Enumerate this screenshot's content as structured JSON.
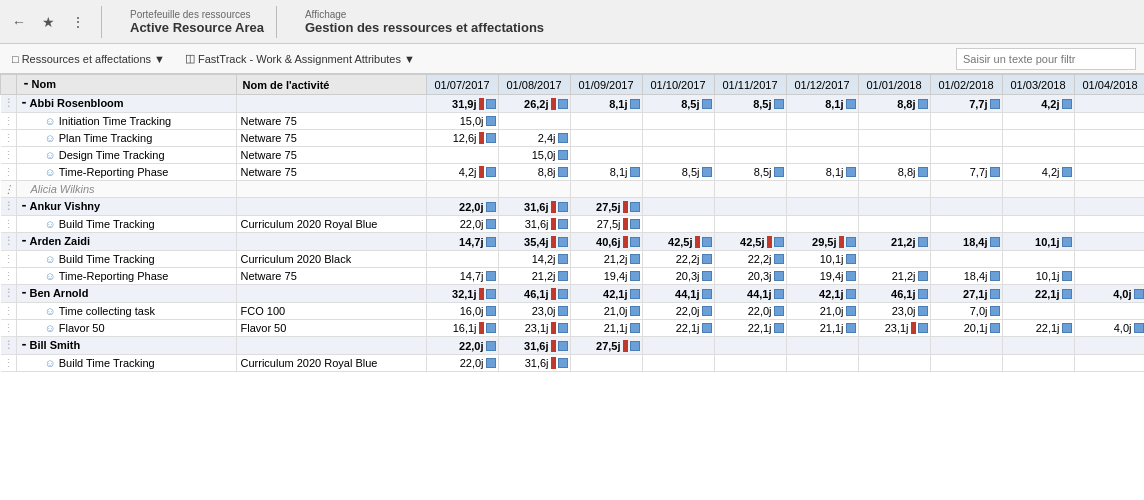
{
  "topbar": {
    "portfolio_label": "Portefeuille des ressources",
    "portfolio_title": "Active Resource Area",
    "affichage_label": "Affichage",
    "affichage_title": "Gestion des ressources et affectations"
  },
  "toolbar": {
    "resources_btn": "Ressources et affectations",
    "fasttrack_btn": "FastTrack - Work & Assignment Attributes",
    "search_placeholder": "Saisir un texte pour filtr"
  },
  "columns": {
    "name": "Nom",
    "activity": "Nom de l'activité",
    "dates": [
      "01/07/2017",
      "01/08/2017",
      "01/09/2017",
      "01/10/2017",
      "01/11/2017",
      "01/12/2017",
      "01/01/2018",
      "01/02/2018",
      "01/03/2018",
      "01/04/2018"
    ]
  },
  "rows": [
    {
      "type": "group",
      "name": "Abbi Rosenbloom",
      "activity": "",
      "vals": [
        "31,9j",
        "26,2j",
        "8,1j",
        "8,5j",
        "8,5j",
        "8,1j",
        "8,8j",
        "7,7j",
        "4,2j",
        ""
      ],
      "hasRed": [
        true,
        true,
        false,
        false,
        false,
        false,
        false,
        false,
        false,
        false
      ]
    },
    {
      "type": "sub",
      "name": "Initiation Time Tracking",
      "activity": "Netware 75",
      "vals": [
        "15,0j",
        "",
        "",
        "",
        "",
        "",
        "",
        "",
        "",
        ""
      ],
      "hasRed": [
        false,
        false,
        false,
        false,
        false,
        false,
        false,
        false,
        false,
        false
      ]
    },
    {
      "type": "sub",
      "name": "Plan Time Tracking",
      "activity": "Netware 75",
      "vals": [
        "12,6j",
        "2,4j",
        "",
        "",
        "",
        "",
        "",
        "",
        "",
        ""
      ],
      "hasRed": [
        true,
        false,
        false,
        false,
        false,
        false,
        false,
        false,
        false,
        false
      ]
    },
    {
      "type": "sub",
      "name": "Design Time Tracking",
      "activity": "Netware 75",
      "vals": [
        "",
        "15,0j",
        "",
        "",
        "",
        "",
        "",
        "",
        "",
        ""
      ],
      "hasRed": [
        false,
        false,
        false,
        false,
        false,
        false,
        false,
        false,
        false,
        false
      ]
    },
    {
      "type": "sub",
      "name": "Time-Reporting Phase",
      "activity": "Netware 75",
      "vals": [
        "4,2j",
        "8,8j",
        "8,1j",
        "8,5j",
        "8,5j",
        "8,1j",
        "8,8j",
        "7,7j",
        "4,2j",
        ""
      ],
      "hasRed": [
        true,
        false,
        false,
        false,
        false,
        false,
        false,
        false,
        false,
        false
      ]
    },
    {
      "type": "person",
      "name": "Alicia Wilkins",
      "activity": "",
      "vals": [
        "",
        "",
        "",
        "",
        "",
        "",
        "",
        "",
        "",
        ""
      ]
    },
    {
      "type": "group",
      "name": "Ankur Vishny",
      "activity": "",
      "vals": [
        "22,0j",
        "31,6j",
        "27,5j",
        "",
        "",
        "",
        "",
        "",
        "",
        ""
      ],
      "hasRed": [
        false,
        true,
        true,
        false,
        false,
        false,
        false,
        false,
        false,
        false
      ]
    },
    {
      "type": "sub",
      "name": "Build Time Tracking",
      "activity": "Curriculum 2020 Royal Blue",
      "vals": [
        "22,0j",
        "31,6j",
        "27,5j",
        "",
        "",
        "",
        "",
        "",
        "",
        ""
      ],
      "hasRed": [
        false,
        true,
        true,
        false,
        false,
        false,
        false,
        false,
        false,
        false
      ]
    },
    {
      "type": "group",
      "name": "Arden Zaidi",
      "activity": "",
      "vals": [
        "14,7j",
        "35,4j",
        "40,6j",
        "42,5j",
        "42,5j",
        "29,5j",
        "21,2j",
        "18,4j",
        "10,1j",
        ""
      ],
      "hasRed": [
        false,
        true,
        true,
        true,
        true,
        true,
        false,
        false,
        false,
        false
      ]
    },
    {
      "type": "sub",
      "name": "Build Time Tracking",
      "activity": "Curriculum 2020 Black",
      "vals": [
        "",
        "14,2j",
        "21,2j",
        "22,2j",
        "22,2j",
        "10,1j",
        "",
        "",
        "",
        ""
      ],
      "hasRed": [
        false,
        false,
        false,
        false,
        false,
        false,
        false,
        false,
        false,
        false
      ]
    },
    {
      "type": "sub",
      "name": "Time-Reporting Phase",
      "activity": "Netware 75",
      "vals": [
        "14,7j",
        "21,2j",
        "19,4j",
        "20,3j",
        "20,3j",
        "19,4j",
        "21,2j",
        "18,4j",
        "10,1j",
        ""
      ],
      "hasRed": [
        false,
        false,
        false,
        false,
        false,
        false,
        false,
        false,
        false,
        false
      ]
    },
    {
      "type": "group",
      "name": "Ben Arnold",
      "activity": "",
      "vals": [
        "32,1j",
        "46,1j",
        "42,1j",
        "44,1j",
        "44,1j",
        "42,1j",
        "46,1j",
        "27,1j",
        "22,1j",
        "4,0j"
      ],
      "hasRed": [
        true,
        true,
        false,
        false,
        false,
        false,
        false,
        false,
        false,
        false
      ]
    },
    {
      "type": "sub",
      "name": "Time collecting task",
      "activity": "FCO 100",
      "vals": [
        "16,0j",
        "23,0j",
        "21,0j",
        "22,0j",
        "22,0j",
        "21,0j",
        "23,0j",
        "7,0j",
        "",
        ""
      ],
      "hasRed": [
        false,
        false,
        false,
        false,
        false,
        false,
        false,
        false,
        false,
        false
      ]
    },
    {
      "type": "sub",
      "name": "Flavor 50",
      "activity": "Flavor 50",
      "vals": [
        "16,1j",
        "23,1j",
        "21,1j",
        "22,1j",
        "22,1j",
        "21,1j",
        "23,1j",
        "20,1j",
        "22,1j",
        "4,0j"
      ],
      "hasRed": [
        true,
        true,
        false,
        false,
        false,
        false,
        true,
        false,
        false,
        false
      ]
    },
    {
      "type": "group",
      "name": "Bill Smith",
      "activity": "",
      "vals": [
        "22,0j",
        "31,6j",
        "27,5j",
        "",
        "",
        "",
        "",
        "",
        "",
        ""
      ],
      "hasRed": [
        false,
        true,
        true,
        false,
        false,
        false,
        false,
        false,
        false,
        false
      ]
    },
    {
      "type": "sub",
      "name": "Build Time Tracking",
      "activity": "Curriculum 2020 Royal Blue",
      "vals": [
        "22,0j",
        "31,6j",
        "",
        "",
        "",
        "",
        "",
        "",
        "",
        ""
      ],
      "hasRed": [
        false,
        true,
        false,
        false,
        false,
        false,
        false,
        false,
        false,
        false
      ]
    }
  ]
}
